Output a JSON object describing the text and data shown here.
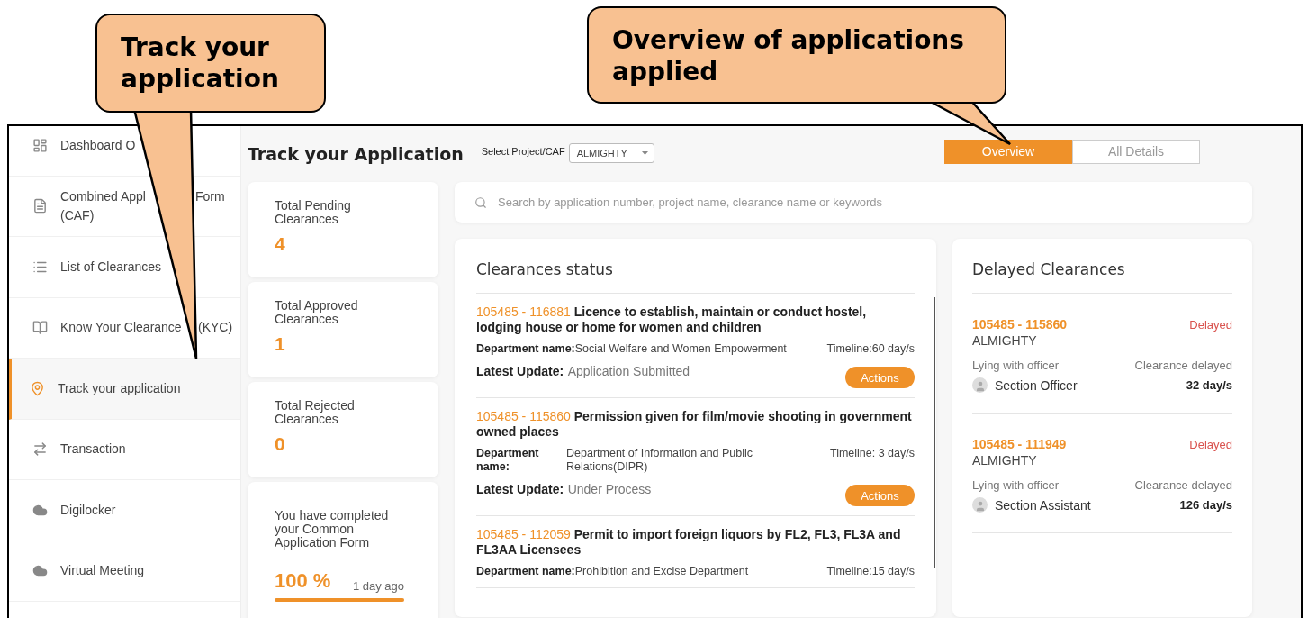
{
  "callouts": [
    {
      "text": "Track your application"
    },
    {
      "text": "Overview of applications applied"
    }
  ],
  "sidebar": {
    "items": [
      {
        "kind": "dashboard",
        "label": "Dashboard O",
        "selected": false
      },
      {
        "kind": "document",
        "label": "Combined Appl",
        "label_after": "Form",
        "line2": "(CAF)",
        "selected": false
      },
      {
        "kind": "list",
        "label": "List of Clearances",
        "selected": false
      },
      {
        "kind": "book",
        "label": "Know Your Clearance",
        "label_after": "(KYC)",
        "selected": false
      },
      {
        "kind": "pin",
        "label": "Track your application",
        "selected": true
      },
      {
        "kind": "transaction",
        "label": "Transaction",
        "selected": false
      },
      {
        "kind": "cloud",
        "label": "Digilocker",
        "selected": false
      },
      {
        "kind": "cloud",
        "label": "Virtual Meeting",
        "selected": false
      }
    ]
  },
  "header": {
    "title": "Track your Application",
    "project_label": "Select Project/CAF",
    "project_value": "ALMIGHTY",
    "view_tabs": [
      {
        "label": "Overview",
        "selected": true
      },
      {
        "label": "All Details",
        "selected": false
      }
    ]
  },
  "stats": [
    {
      "label": "Total Pending Clearances",
      "value": "4"
    },
    {
      "label": "Total Approved Clearances",
      "value": "1"
    },
    {
      "label": "Total Rejected Clearances",
      "value": "0"
    }
  ],
  "completion": {
    "text": "You have completed your Common Application Form",
    "percent": "100 %",
    "time": "1 day ago",
    "level": 1
  },
  "search": {
    "placeholder": "Search by application number, project name, clearance name or keywords"
  },
  "clearances_status": {
    "title": "Clearances status",
    "items": [
      {
        "kind": "inline",
        "id": "105485 - 116881",
        "title": "Licence to establish, maintain or conduct hostel, lodging house or home for women and children",
        "department_label": "Department name:",
        "department": "Social Welfare and Women Empowerment",
        "timeline": "Timeline:60 day/s",
        "update_label": "Latest Update:",
        "update": "Application Submitted",
        "action": "Actions"
      },
      {
        "kind": "columns",
        "id": "105485 - 115860",
        "title": "Permission given for film/movie shooting in government owned places",
        "department_label": "Department name:",
        "department": "Department of Information and Public Relations(DIPR)",
        "timeline": "Timeline: 3 day/s",
        "update_label": "Latest Update:",
        "update": "Under Process",
        "action": "Actions"
      },
      {
        "kind": "inline",
        "id": "105485 - 112059",
        "title": "Permit to import foreign liquors by FL2, FL3, FL3A and FL3AA Licensees",
        "department_label": "Department name:",
        "department": "Prohibition and Excise Department",
        "timeline": "Timeline:15 day/s"
      }
    ]
  },
  "delayed_clearances": {
    "title": "Delayed Clearances",
    "items": [
      {
        "id": "105485 - 115860",
        "status": "Delayed",
        "project": "ALMIGHTY",
        "officer_label": "Lying with officer",
        "delay_label": "Clearance delayed",
        "officer": "Section Officer",
        "days": "32 day/s"
      },
      {
        "id": "105485 - 111949",
        "status": "Delayed",
        "project": "ALMIGHTY",
        "officer_label": "Lying with officer",
        "delay_label": "Clearance delayed",
        "officer": "Section Assistant",
        "days": "126 day/s"
      }
    ]
  }
}
